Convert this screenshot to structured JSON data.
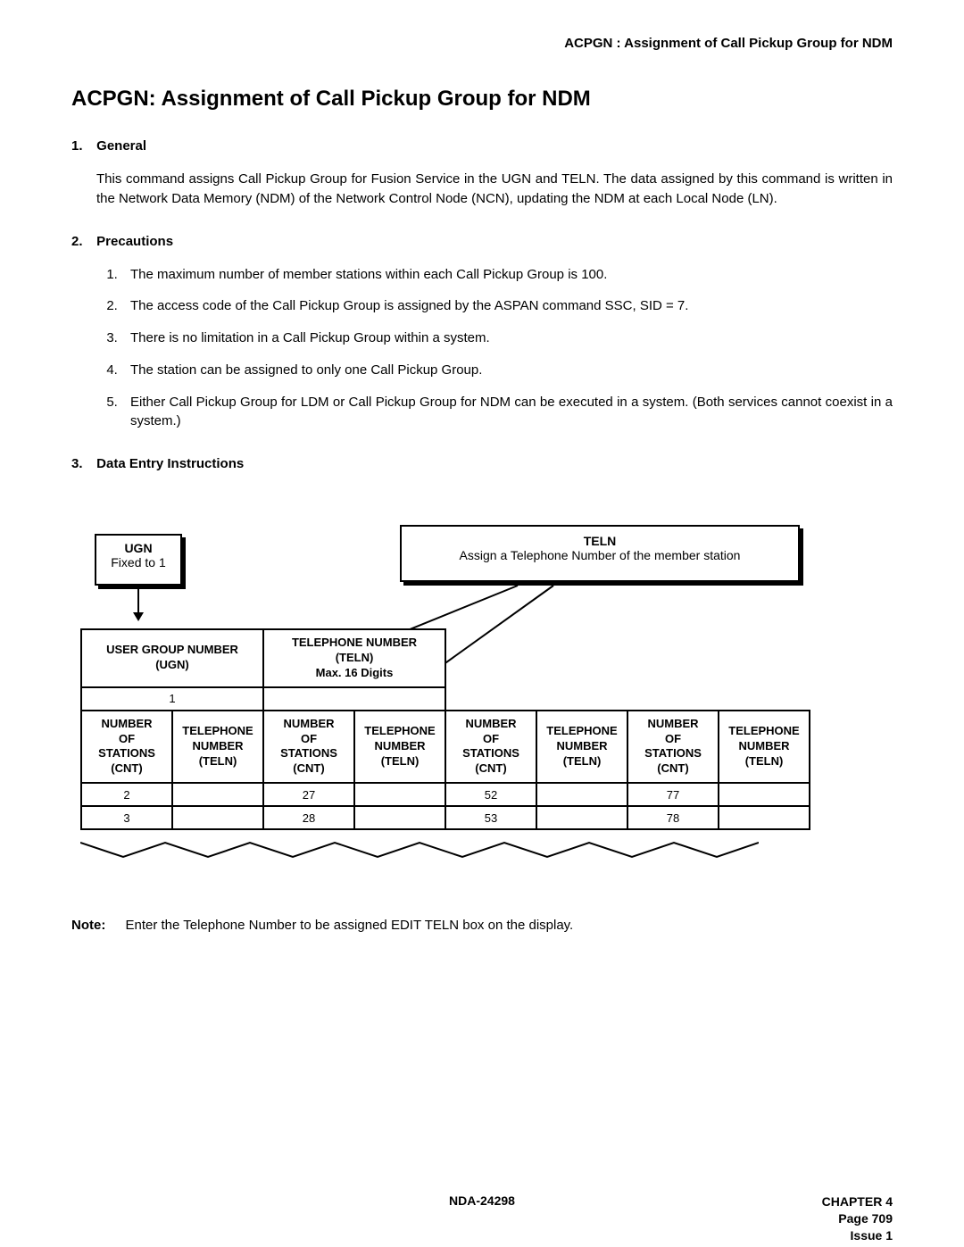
{
  "header_right": "ACPGN : Assignment of Call Pickup Group for NDM",
  "title": "ACPGN: Assignment of Call Pickup Group for NDM",
  "sections": {
    "s1": {
      "num": "1.",
      "label": "General"
    },
    "s2": {
      "num": "2.",
      "label": "Precautions"
    },
    "s3": {
      "num": "3.",
      "label": "Data Entry Instructions"
    }
  },
  "general_text": "This command assigns Call Pickup Group for Fusion Service in the UGN and TELN. The data assigned by this command is written in the Network Data Memory (NDM) of the Network Control Node (NCN), updating the NDM at each Local Node (LN).",
  "precautions": [
    "The maximum number of member stations within each Call Pickup Group is 100.",
    "The access code of the Call Pickup Group is assigned by the ASPAN command SSC, SID = 7.",
    "There is no limitation in a Call Pickup Group within a system.",
    "The station can be assigned to only one Call Pickup Group.",
    "Either Call Pickup Group for LDM or Call Pickup Group for NDM can be executed in a system. (Both services cannot coexist in a system.)"
  ],
  "diagram": {
    "ugn": {
      "title": "UGN",
      "sub": "Fixed to 1"
    },
    "teln": {
      "title": "TELN",
      "sub": "Assign a Telephone Number of the member station"
    },
    "top_headers": {
      "ugn": "USER GROUP NUMBER\n(UGN)",
      "teln": "TELEPHONE NUMBER\n(TELN)\nMax. 16 Digits"
    },
    "ugn_value_row": "1",
    "col_pair_header_a": "NUMBER\nOF\nSTATIONS\n(CNT)",
    "col_pair_header_b": "TELEPHONE\nNUMBER\n(TELN)",
    "rows": [
      {
        "c1": "2",
        "c2": "",
        "c3": "27",
        "c4": "",
        "c5": "52",
        "c6": "",
        "c7": "77",
        "c8": ""
      },
      {
        "c1": "3",
        "c2": "",
        "c3": "28",
        "c4": "",
        "c5": "53",
        "c6": "",
        "c7": "78",
        "c8": ""
      }
    ]
  },
  "note": {
    "label": "Note:",
    "text_a": "Enter the Telephone Number to be assigned",
    "text_b": "EDIT TELN",
    "text_c": "box on the display."
  },
  "footer": {
    "center": "NDA-24298",
    "chapter": "CHAPTER 4",
    "page": "Page 709",
    "issue": "Issue 1"
  }
}
